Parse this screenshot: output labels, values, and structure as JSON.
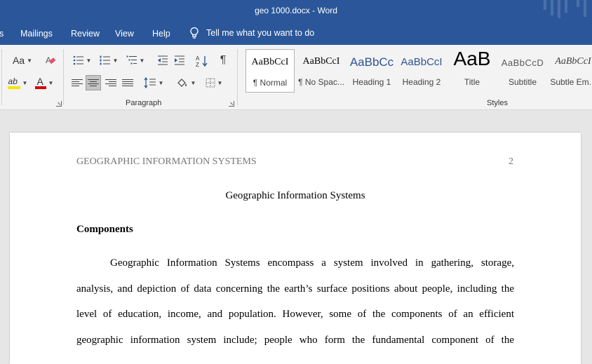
{
  "window": {
    "title": "geo 1000.docx  -  Word"
  },
  "tabs": {
    "partial": "s",
    "mailings": "Mailings",
    "review": "Review",
    "view": "View",
    "help": "Help",
    "tell_me": "Tell me what you want to do"
  },
  "ribbon": {
    "font_change_case": "Aa",
    "font_color_letter": "A",
    "highlight_letters": "ab",
    "paragraph_label": "Paragraph",
    "styles_label": "Styles",
    "highlight_color": "#f5e400",
    "font_color": "#d40000",
    "styles": [
      {
        "preview": "AaBbCcI",
        "name": "¶ Normal"
      },
      {
        "preview": "AaBbCcI",
        "name": "¶ No Spac..."
      },
      {
        "preview": "AaBbCc",
        "name": "Heading 1"
      },
      {
        "preview": "AaBbCcI",
        "name": "Heading 2"
      },
      {
        "preview": "AaB",
        "name": "Title"
      },
      {
        "preview": "AaBbCcD",
        "name": "Subtitle"
      },
      {
        "preview": "AaBbCcI",
        "name": "Subtle Em..."
      }
    ]
  },
  "document": {
    "header": "GEOGRAPHIC INFORMATION SYSTEMS",
    "page_number": "2",
    "title": "Geographic Information Systems",
    "heading": "Components",
    "lines": [
      "Geographic Information Systems encompass a system involved in gathering, storage,",
      "analysis, and depiction of data concerning the earth’s surface positions about people, including the",
      "level of education, income, and population. However, some of the components of an efficient",
      "geographic information system include; people who form the fundamental component of the"
    ]
  },
  "colors": {
    "accent": "#2b579a",
    "heading_blue": "#2f5496"
  }
}
